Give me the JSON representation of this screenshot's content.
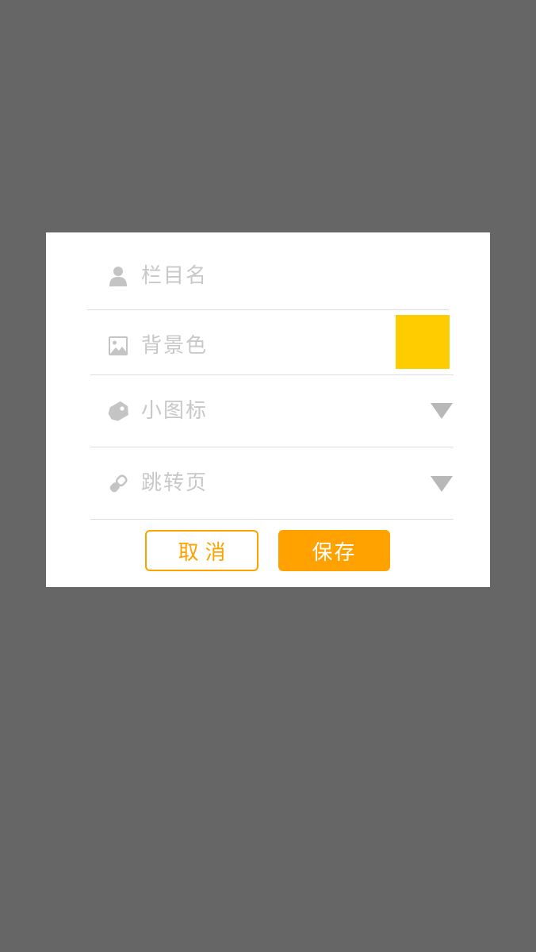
{
  "colors": {
    "overlay": "#666666",
    "dialog_bg": "#ffffff",
    "accent": "#ffa200",
    "swatch": "#ffcc00",
    "placeholder_text": "#c8c8c8",
    "divider": "#dddddd"
  },
  "dialog": {
    "fields": [
      {
        "icon": "person-icon",
        "label": "栏目名"
      },
      {
        "icon": "image-icon",
        "label": "背景色",
        "selected_color": "#ffcc00"
      },
      {
        "icon": "tag-icon",
        "label": "小图标"
      },
      {
        "icon": "link-icon",
        "label": "跳转页"
      }
    ],
    "buttons": {
      "cancel_label": "取消",
      "save_label": "保存"
    }
  }
}
